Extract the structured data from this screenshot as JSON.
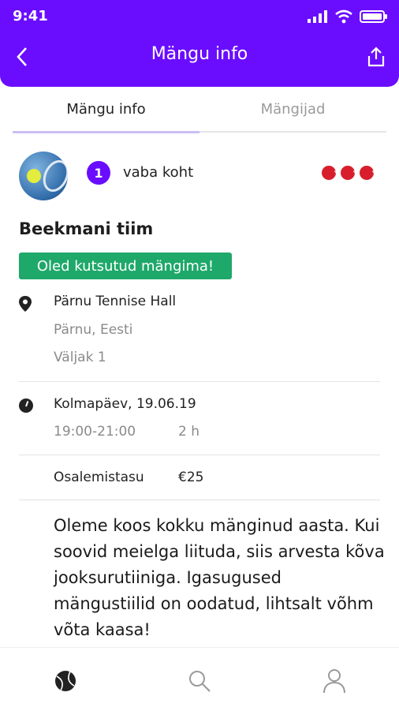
{
  "status_bar": {
    "time": "9:41"
  },
  "header": {
    "title": "Mängu info"
  },
  "tabs": [
    {
      "label": "Mängu info",
      "active": true
    },
    {
      "label": "Mängijad",
      "active": false
    }
  ],
  "game": {
    "free_spots_count": "1",
    "free_spots_label": "vaba koht",
    "team_name": "Beekmani tiim",
    "invite_badge": "Oled kutsutud mängima!",
    "location": {
      "name": "Pärnu Tennise Hall",
      "city": "Pärnu, Eesti",
      "court": "Väljak 1"
    },
    "datetime": {
      "date": "Kolmapäev, 19.06.19",
      "time": "19:00-21:00",
      "duration": "2 h"
    },
    "fee": {
      "label": "Osalemistasu",
      "value": "€25"
    },
    "description": "Oleme koos kokku mänginud aasta. Kui soovid meielga liituda, siis arvesta kõva jooksurutiiniga. Igasugused mängustiilid on oodatud, lihtsalt võhm võta kaasa!"
  },
  "colors": {
    "accent": "#6a0dff",
    "invite_green": "#1ea86a",
    "ball_red": "#d81e2c"
  },
  "icons": [
    "back-icon",
    "share-icon",
    "location-pin-icon",
    "clock-icon",
    "tennis-ball-icon",
    "search-icon",
    "profile-icon"
  ]
}
